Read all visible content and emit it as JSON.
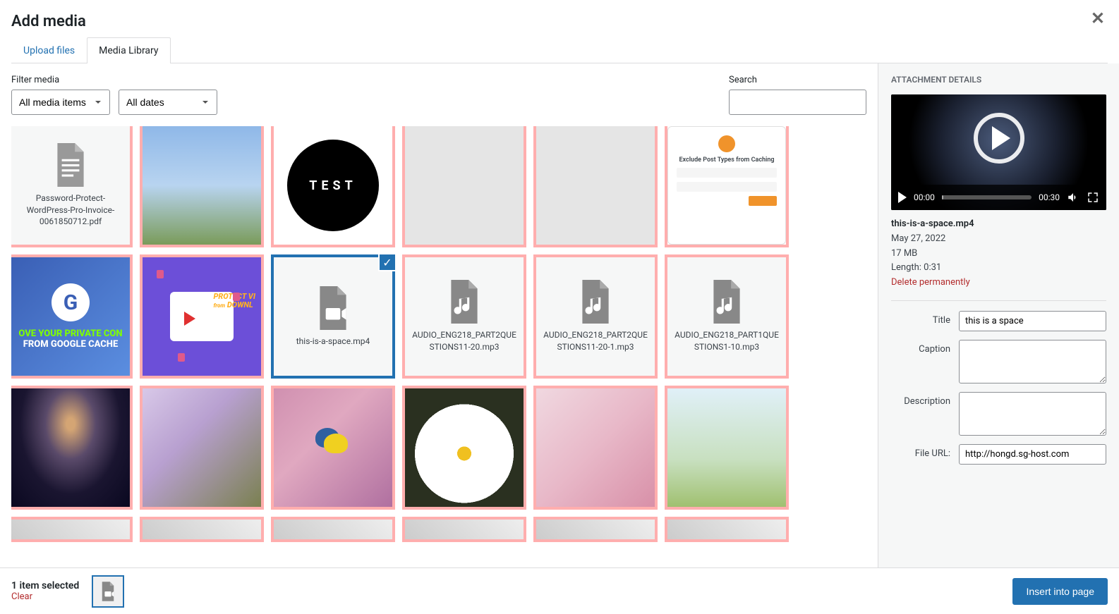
{
  "header": {
    "title": "Add media"
  },
  "tabs": {
    "upload": "Upload files",
    "library": "Media Library"
  },
  "toolbar": {
    "filter_label": "Filter media",
    "type_select": "All media items",
    "date_select": "All dates",
    "search_label": "Search",
    "search_value": ""
  },
  "grid": [
    {
      "kind": "doc",
      "caption": "Password-Protect-WordPress-Pro-Invoice-0061850712.pdf"
    },
    {
      "kind": "image",
      "visual": "butterfly"
    },
    {
      "kind": "image",
      "visual": "test",
      "text": "TEST"
    },
    {
      "kind": "blank"
    },
    {
      "kind": "blank"
    },
    {
      "kind": "image",
      "visual": "exclude",
      "text": "Exclude Post Types from Caching"
    },
    {
      "kind": "image",
      "visual": "gcache",
      "line1": "OVE YOUR PRIVATE CON",
      "line2": "FROM GOOGLE CACHE"
    },
    {
      "kind": "image",
      "visual": "protect",
      "line1": "PROTECT VI",
      "line2": "from",
      "line3": "DOWNL"
    },
    {
      "kind": "video",
      "caption": "this-is-a-space.mp4",
      "selected": true
    },
    {
      "kind": "audio",
      "caption": "AUDIO_ENG218_PART2QUESTIONS11-20.mp3"
    },
    {
      "kind": "audio",
      "caption": "AUDIO_ENG218_PART2QUESTIONS11-20-1.mp3"
    },
    {
      "kind": "audio",
      "caption": "AUDIO_ENG218_PART1QUESTIONS1-10.mp3"
    },
    {
      "kind": "image",
      "visual": "galaxy"
    },
    {
      "kind": "image",
      "visual": "wisteria"
    },
    {
      "kind": "image",
      "visual": "bird"
    },
    {
      "kind": "image",
      "visual": "daisy"
    },
    {
      "kind": "image",
      "visual": "sakura"
    },
    {
      "kind": "image",
      "visual": "bfly2"
    }
  ],
  "sidebar": {
    "heading": "ATTACHMENT DETAILS",
    "video": {
      "current_time": "00:00",
      "duration": "00:30"
    },
    "filename": "this-is-a-space.mp4",
    "date": "May 27, 2022",
    "size": "17 MB",
    "length_label": "Length: 0:31",
    "delete": "Delete permanently",
    "fields": {
      "title_label": "Title",
      "title_value": "this is a space",
      "caption_label": "Caption",
      "caption_value": "",
      "description_label": "Description",
      "description_value": "",
      "fileurl_label": "File URL:",
      "fileurl_value": "http://hongd.sg-host.com"
    }
  },
  "footer": {
    "selected_text": "1 item selected",
    "clear": "Clear",
    "insert": "Insert into page"
  }
}
